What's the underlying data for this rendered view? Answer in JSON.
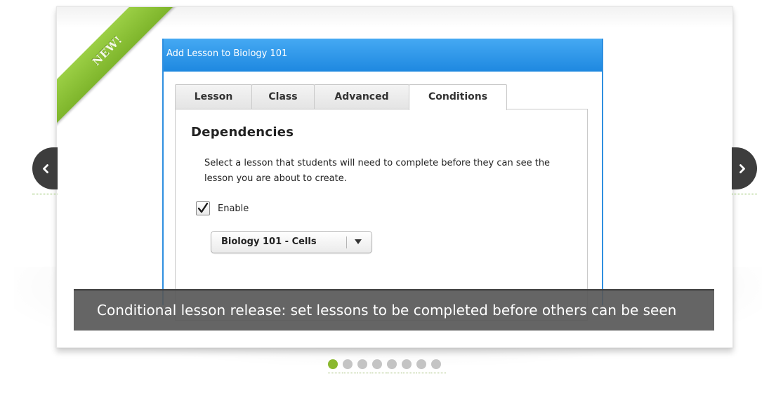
{
  "slider": {
    "badge": "NEW!",
    "caption": "Conditional lesson release: set lessons to be completed before others can be seen",
    "slide_count": 8,
    "active_slide": 1,
    "accent_color": "#8ab82f"
  },
  "dialog": {
    "title": "Add Lesson to Biology 101",
    "title_bar_color": "#1e88e0",
    "tabs": [
      {
        "label": "Lesson",
        "active": false
      },
      {
        "label": "Class",
        "active": false
      },
      {
        "label": "Advanced",
        "active": false
      },
      {
        "label": "Conditions",
        "active": true
      }
    ],
    "panel": {
      "heading": "Dependencies",
      "description": "Select a lesson that students will need to complete before they can see the lesson you are about to create.",
      "enable_label": "Enable",
      "enable_checked": true,
      "select_value": "Biology 101 - Cells"
    }
  },
  "icons": {
    "prev": "chevron-left-icon",
    "next": "chevron-right-icon",
    "checkbox": "checkmark-icon",
    "dropdown": "caret-down-icon"
  }
}
